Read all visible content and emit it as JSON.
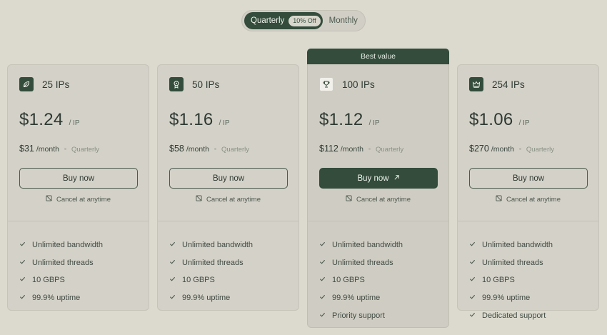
{
  "toggle": {
    "active_label": "Quarterly",
    "badge": "10% Off",
    "inactive_label": "Monthly"
  },
  "cards": [
    {
      "name": "25 IPs",
      "icon": "leaf-icon",
      "price": "$1.24",
      "per": "/ IP",
      "month_amount": "$31",
      "month_unit": "/month",
      "term": "Quarterly",
      "buy_label": "Buy now",
      "cancel_label": "Cancel at anytime",
      "features": [
        "Unlimited bandwidth",
        "Unlimited threads",
        "10 GBPS",
        "99.9% uptime"
      ]
    },
    {
      "name": "50 IPs",
      "icon": "award-icon",
      "price": "$1.16",
      "per": "/ IP",
      "month_amount": "$58",
      "month_unit": "/month",
      "term": "Quarterly",
      "buy_label": "Buy now",
      "cancel_label": "Cancel at anytime",
      "features": [
        "Unlimited bandwidth",
        "Unlimited threads",
        "10 GBPS",
        "99.9% uptime"
      ]
    },
    {
      "banner": "Best value",
      "name": "100 IPs",
      "icon": "trophy-icon",
      "price": "$1.12",
      "per": "/ IP",
      "month_amount": "$112",
      "month_unit": "/month",
      "term": "Quarterly",
      "buy_label": "Buy now",
      "cancel_label": "Cancel at anytime",
      "features": [
        "Unlimited bandwidth",
        "Unlimited threads",
        "10 GBPS",
        "99.9% uptime",
        "Priority support"
      ]
    },
    {
      "name": "254 IPs",
      "icon": "crown-icon",
      "price": "$1.06",
      "per": "/ IP",
      "month_amount": "$270",
      "month_unit": "/month",
      "term": "Quarterly",
      "buy_label": "Buy now",
      "cancel_label": "Cancel at anytime",
      "features": [
        "Unlimited bandwidth",
        "Unlimited threads",
        "10 GBPS",
        "99.9% uptime",
        "Dedicated support"
      ]
    }
  ],
  "colors": {
    "background": "#dcdacf",
    "accent": "#334c3c",
    "card": "#d3d1c8"
  }
}
